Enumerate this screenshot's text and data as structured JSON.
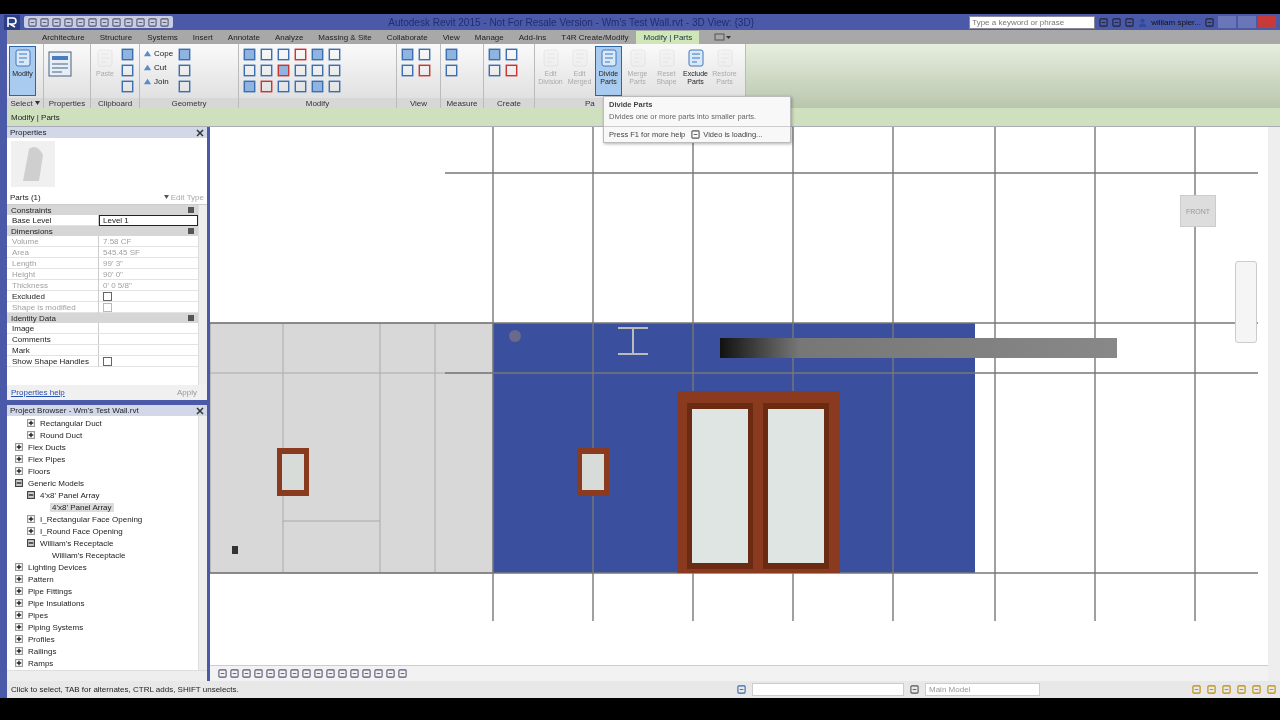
{
  "window": {
    "title": "Autodesk Revit 2015 - Not For Resale Version - Wm's Test Wall.rvt - 3D View: {3D}",
    "search": {
      "placeholder": "Type a keyword or phrase"
    },
    "user": "william spier..."
  },
  "tabs": [
    {
      "label": "Architecture",
      "selected": false
    },
    {
      "label": "Structure",
      "selected": false
    },
    {
      "label": "Systems",
      "selected": false
    },
    {
      "label": "Insert",
      "selected": false
    },
    {
      "label": "Annotate",
      "selected": false
    },
    {
      "label": "Analyze",
      "selected": false
    },
    {
      "label": "Massing & Site",
      "selected": false
    },
    {
      "label": "Collaborate",
      "selected": false
    },
    {
      "label": "View",
      "selected": false
    },
    {
      "label": "Manage",
      "selected": false
    },
    {
      "label": "Add-Ins",
      "selected": false
    },
    {
      "label": "T4R Create/Modify",
      "selected": false
    },
    {
      "label": "Modify | Parts",
      "selected": true
    }
  ],
  "ribbon": [
    {
      "label": "Select",
      "buttons": [
        {
          "kind": "large",
          "label": "Modify",
          "disabled": false,
          "selected": true
        }
      ]
    },
    {
      "label": "Properties",
      "buttons": [
        {
          "kind": "large_icon",
          "disabled": false
        }
      ]
    },
    {
      "label": "Clipboard",
      "buttons": [
        {
          "kind": "large",
          "label": "Paste",
          "disabled": true,
          "selected": false
        }
      ]
    },
    {
      "label": "Geometry",
      "buttons": [
        {
          "kind": "small",
          "label": "Cope",
          "disabled": false
        },
        {
          "kind": "small",
          "label": "Cut",
          "disabled": false
        },
        {
          "kind": "small",
          "label": "Join",
          "disabled": false
        }
      ]
    },
    {
      "label": "Modify"
    },
    {
      "label": "View"
    },
    {
      "label": "Measure"
    },
    {
      "label": "Create"
    },
    {
      "label": "Pa",
      "buttons": [
        {
          "kind": "large",
          "label": "Edit Division",
          "disabled": true,
          "selected": false
        },
        {
          "kind": "large",
          "label": "Edit Merged",
          "disabled": true,
          "selected": false
        },
        {
          "kind": "large",
          "label": "Divide Parts",
          "disabled": false,
          "selected": true
        },
        {
          "kind": "large",
          "label": "Merge Parts",
          "disabled": true,
          "selected": false
        },
        {
          "kind": "large",
          "label": "Reset Shape",
          "disabled": true,
          "selected": false
        },
        {
          "kind": "large",
          "label": "Exclude Parts",
          "disabled": false,
          "selected": false
        },
        {
          "kind": "large",
          "label": "Restore Parts",
          "disabled": true,
          "selected": false
        }
      ]
    }
  ],
  "options_bar": {
    "label": "Modify | Parts"
  },
  "tooltip": {
    "title": "Divide Parts",
    "description": "Divides one or more parts into smaller parts.",
    "help": "Press F1 for more help",
    "video": "Video is loading..."
  },
  "properties": {
    "title": "Properties",
    "type_selector": "Parts (1)",
    "edit_type": "Edit Type",
    "rows": [
      {
        "kind": "group",
        "label": "Constraints"
      },
      {
        "kind": "text",
        "label": "Base Level",
        "value": "Level 1",
        "disabled": false,
        "editing": true
      },
      {
        "kind": "group",
        "label": "Dimensions"
      },
      {
        "kind": "text",
        "label": "Volume",
        "value": "7.58 CF",
        "disabled": true,
        "editing": false
      },
      {
        "kind": "text",
        "label": "Area",
        "value": "545.45 SF",
        "disabled": true,
        "editing": false
      },
      {
        "kind": "text",
        "label": "Length",
        "value": "99' 3\"",
        "disabled": true,
        "editing": false
      },
      {
        "kind": "text",
        "label": "Height",
        "value": "90' 0\"",
        "disabled": true,
        "editing": false
      },
      {
        "kind": "text",
        "label": "Thickness",
        "value": "0' 0 5/8\"",
        "disabled": true,
        "editing": false
      },
      {
        "kind": "checkbox",
        "label": "Excluded",
        "checked": false,
        "disabled": false
      },
      {
        "kind": "checkbox",
        "label": "Shape is modified",
        "checked": false,
        "disabled": true
      },
      {
        "kind": "group",
        "label": "Identity Data"
      },
      {
        "kind": "text",
        "label": "Image",
        "disabled": false,
        "editing": false
      },
      {
        "kind": "text",
        "label": "Comments",
        "disabled": false,
        "editing": false
      },
      {
        "kind": "text",
        "label": "Mark",
        "disabled": false,
        "editing": false
      },
      {
        "kind": "checkbox",
        "label": "Show Shape Handles",
        "checked": false,
        "disabled": false
      }
    ],
    "help_link": "Properties help",
    "apply": "Apply"
  },
  "project_browser": {
    "title": "Project Browser - Wm's Test Wall.rvt",
    "continued": [
      {
        "label": "Rectangular Duct",
        "expanded": false,
        "selected": false
      },
      {
        "label": "Round Duct",
        "expanded": false,
        "selected": false
      }
    ],
    "items": [
      {
        "label": "Flex Ducts",
        "expanded": false,
        "selected": false
      },
      {
        "label": "Flex Pipes",
        "expanded": false,
        "selected": false
      },
      {
        "label": "Floors",
        "expanded": false,
        "selected": false
      },
      {
        "label": "Generic Models",
        "expanded": true,
        "selected": false,
        "children": [
          {
            "label": "4'x8' Panel Array",
            "expanded": true,
            "selected": false,
            "children": [
              {
                "label": "4'x8' Panel Array",
                "selected": true
              }
            ]
          },
          {
            "label": "I_Rectangular Face Opening",
            "expanded": false,
            "selected": false
          },
          {
            "label": "I_Round Face Opening",
            "expanded": false,
            "selected": false
          },
          {
            "label": "William's Receptacle",
            "expanded": true,
            "selected": false,
            "children": [
              {
                "label": "William's Receptacle",
                "selected": false
              }
            ]
          }
        ]
      },
      {
        "label": "Lighting Devices",
        "expanded": false,
        "selected": false
      },
      {
        "label": "Pattern",
        "expanded": false,
        "selected": false
      },
      {
        "label": "Pipe Fittings",
        "expanded": false,
        "selected": false
      },
      {
        "label": "Pipe Insulations",
        "expanded": false,
        "selected": false
      },
      {
        "label": "Pipes",
        "expanded": false,
        "selected": false
      },
      {
        "label": "Piping Systems",
        "expanded": false,
        "selected": false
      },
      {
        "label": "Profiles",
        "expanded": false,
        "selected": false
      },
      {
        "label": "Railings",
        "expanded": false,
        "selected": false
      },
      {
        "label": "Ramps",
        "expanded": false,
        "selected": false
      }
    ]
  },
  "view_cube": {
    "face": "FRONT"
  },
  "status_bar": {
    "message": "Click to select, TAB for alternates, CTRL adds, SHIFT unselects.",
    "model": "Main Model"
  }
}
